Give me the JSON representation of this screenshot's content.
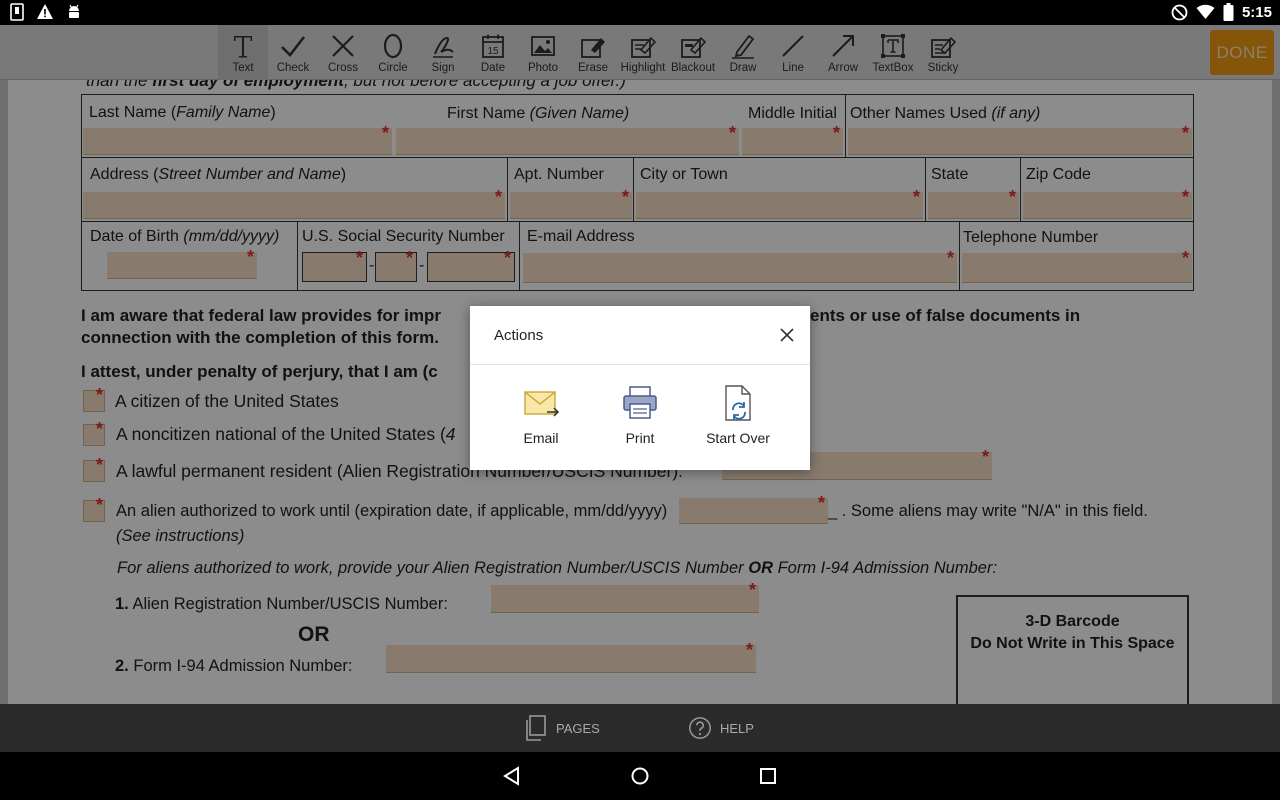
{
  "status_bar": {
    "time": "5:15",
    "left_icons": [
      "sd-card-icon",
      "warning-icon",
      "android-icon"
    ],
    "right_icons": [
      "dnd-icon",
      "wifi-icon",
      "battery-icon"
    ]
  },
  "toolbar": {
    "tools": [
      {
        "label": "Text",
        "icon": "text-tool-icon",
        "active": true
      },
      {
        "label": "Check",
        "icon": "check-tool-icon"
      },
      {
        "label": "Cross",
        "icon": "cross-tool-icon"
      },
      {
        "label": "Circle",
        "icon": "circle-tool-icon"
      },
      {
        "label": "Sign",
        "icon": "sign-tool-icon"
      },
      {
        "label": "Date",
        "icon": "date-tool-icon"
      },
      {
        "label": "Photo",
        "icon": "photo-tool-icon"
      },
      {
        "label": "Erase",
        "icon": "erase-tool-icon"
      },
      {
        "label": "Highlight",
        "icon": "highlight-tool-icon"
      },
      {
        "label": "Blackout",
        "icon": "blackout-tool-icon"
      },
      {
        "label": "Draw",
        "icon": "draw-tool-icon"
      },
      {
        "label": "Line",
        "icon": "line-tool-icon"
      },
      {
        "label": "Arrow",
        "icon": "arrow-tool-icon"
      },
      {
        "label": "TextBox",
        "icon": "textbox-tool-icon"
      },
      {
        "label": "Sticky",
        "icon": "sticky-tool-icon"
      }
    ],
    "date_icon_number": "15",
    "done_label": "DONE",
    "done_color": "#f39c12"
  },
  "document": {
    "top_line": {
      "pre": "than the ",
      "bold": "first day of employment",
      "post": ", but not before accepting a job offer.)"
    },
    "row1": {
      "last_name": {
        "text": "Last Name (",
        "italic": "Family Name",
        "post": ")"
      },
      "first_name": {
        "text": "First Name ",
        "italic": "(Given Name)"
      },
      "middle_initial": "Middle Initial",
      "other_names": {
        "text": "Other Names Used ",
        "italic": "(if any)"
      }
    },
    "row2": {
      "address": {
        "text": "Address (",
        "italic": "Street Number and Name",
        "post": ")"
      },
      "apt": "Apt. Number",
      "city": "City or Town",
      "state": "State",
      "zip": "Zip Code"
    },
    "row3": {
      "dob": {
        "text": "Date of Birth ",
        "italic": "(mm/dd/yyyy)"
      },
      "ssn": "U.S. Social Security Number",
      "email": "E-mail Address",
      "phone": "Telephone Number"
    },
    "ssn_dash": "-",
    "required_marker": "*",
    "aware_text": {
      "line1_left": "I am aware that federal law provides for impr",
      "line1_right": "ents or use of false documents in",
      "line2": "connection with the completion of this form."
    },
    "attest_text": "I attest, under penalty of perjury, that I am (c",
    "options": {
      "citizen": "A citizen of the United States",
      "noncitizen": "A noncitizen national of the United States (",
      "noncitizen_suffix": "4",
      "permanent": "A lawful permanent resident (Alien Registration Number/USCIS Number):",
      "alien_main": "An alien authorized to work until (expiration date, if applicable, mm/dd/yyyy)",
      "alien_after": "_ . Some aliens may write \"N/A\" in this field.",
      "alien_see": "(See instructions)"
    },
    "aliens_instruction": {
      "pre": "For aliens authorized to work, provide your Alien Registration Number/USCIS Number ",
      "bold": "OR",
      "post": " Form I-94 Admission Number:"
    },
    "item1_number": "1.",
    "item1": "Alien Registration Number/USCIS Number:",
    "or_text": "OR",
    "item2_number": "2.",
    "item2": "Form I-94 Admission Number:",
    "barcode": {
      "line1": "3-D Barcode",
      "line2": "Do Not Write in This Space"
    }
  },
  "dialog": {
    "title": "Actions",
    "actions": [
      {
        "label": "Email",
        "icon": "email-icon"
      },
      {
        "label": "Print",
        "icon": "print-icon"
      },
      {
        "label": "Start Over",
        "icon": "start-over-icon"
      }
    ]
  },
  "bottom_bar": {
    "pages": "PAGES",
    "help": "HELP"
  },
  "nav_bar": {
    "buttons": [
      "back-icon",
      "home-icon",
      "recents-icon"
    ]
  }
}
